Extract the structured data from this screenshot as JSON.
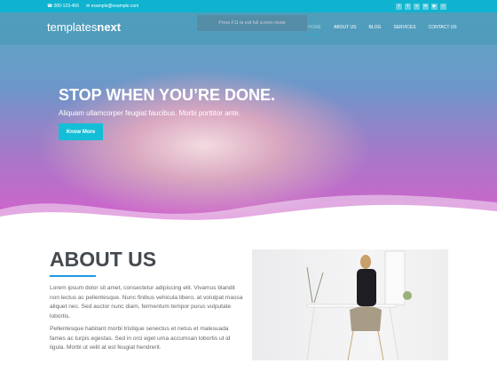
{
  "topbar": {
    "phone": "000-123-456",
    "email": "example@example.com",
    "social_icons": [
      "twitter-icon",
      "facebook-icon",
      "skype-icon",
      "linkedin-icon",
      "youtube-icon",
      "instagram-icon"
    ]
  },
  "header": {
    "logo_a": "templates",
    "logo_b": "ne",
    "logo_c": "xt",
    "nav": [
      "HOME",
      "ABOUT US",
      "BLOG",
      "SERVICES",
      "CONTACT US"
    ]
  },
  "toast": "Press  F11  to exit full screen mode",
  "hero": {
    "title": "STOP WHEN YOU’RE DONE.",
    "subtitle": "Aliquam ullamcorper feugiat faucibus. Morbi porttitor ante.",
    "button": "Know More"
  },
  "about": {
    "title": "ABOUT US",
    "p1": "Lorem ipsum dolor sit amet, consectetur adipiscing elit. Vivamus blandit non lectus ac pellentesque. Nunc finibus vehicula libero, at volutpat massa aliquet nec. Sed auctor nunc diam, fermentum tempor purus vulputate lobortis.",
    "p2": "Pellentesque habitant morbi tristique senectus et netus et malesuada fames ac turpis egestas. Sed in orci eget urna accumsan lobortis ut id ligula. Morbi ut velit at est feugiat hendrerit."
  },
  "colors": {
    "accent": "#0fb3cf",
    "rule": "#1e9ae0"
  }
}
